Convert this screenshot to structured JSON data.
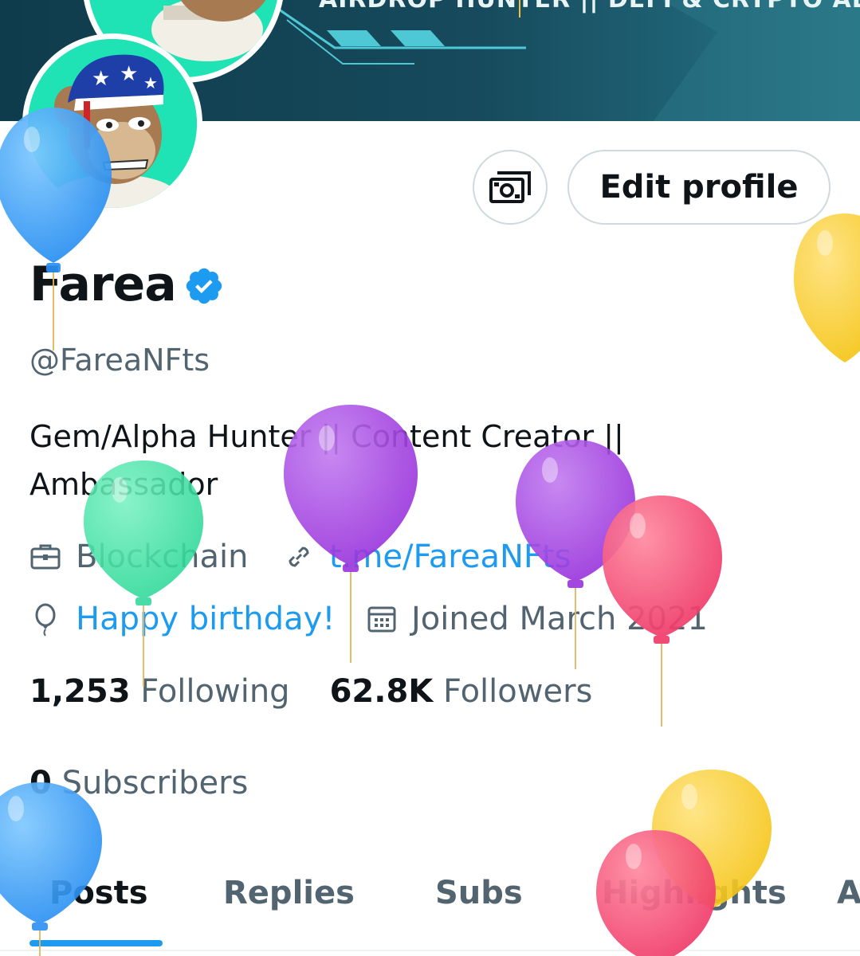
{
  "banner": {
    "text": "AIRDROP HUNTER || DEFI & CRYPTO ALPHA"
  },
  "profile": {
    "name": "Farea",
    "handle": "@FareaNFts",
    "bio": "Gem/Alpha Hunter || Content Creator || Ambassador",
    "category": "Blockchain",
    "link": "t.me/FareaNFts",
    "birthday": "Happy birthday!",
    "joined": "Joined March 2021"
  },
  "buttons": {
    "edit_profile": "Edit profile"
  },
  "stats": {
    "following_count": "1,253",
    "following_label": "Following",
    "followers_count": "62.8K",
    "followers_label": "Followers",
    "subscribers_count": "0",
    "subscribers_label": "Subscribers"
  },
  "tabs": [
    {
      "label": "Posts",
      "active": true
    },
    {
      "label": "Replies",
      "active": false
    },
    {
      "label": "Subs",
      "active": false
    },
    {
      "label": "Highlights",
      "active": false
    },
    {
      "label": "A",
      "active": false
    }
  ],
  "colors": {
    "accent": "#1d9bf0",
    "secondary_text": "#536471",
    "avatar_bg": "#1fe3b5"
  },
  "icons": [
    "money-icon",
    "verified-badge-icon",
    "briefcase-icon",
    "link-icon",
    "balloon-icon",
    "calendar-icon"
  ]
}
